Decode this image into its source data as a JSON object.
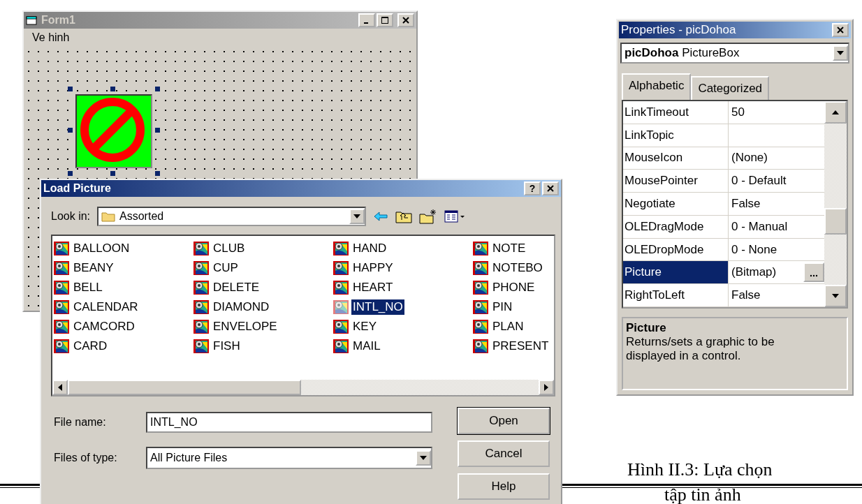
{
  "form_window": {
    "title": "Form1",
    "menu": [
      "Ve hinh"
    ]
  },
  "load_picture_dialog": {
    "title": "Load Picture",
    "help_glyph": "?",
    "look_in": {
      "label": "Look in:",
      "value": "Assorted"
    },
    "files": [
      {
        "name": "BALLOON",
        "selected": false
      },
      {
        "name": "BEANY",
        "selected": false
      },
      {
        "name": "BELL",
        "selected": false
      },
      {
        "name": "CALENDAR",
        "selected": false
      },
      {
        "name": "CAMCORD",
        "selected": false
      },
      {
        "name": "CARD",
        "selected": false
      },
      {
        "name": "CLUB",
        "selected": false
      },
      {
        "name": "CUP",
        "selected": false
      },
      {
        "name": "DELETE",
        "selected": false
      },
      {
        "name": "DIAMOND",
        "selected": false
      },
      {
        "name": "ENVELOPE",
        "selected": false
      },
      {
        "name": "FISH",
        "selected": false
      },
      {
        "name": "HAND",
        "selected": false
      },
      {
        "name": "HAPPY",
        "selected": false
      },
      {
        "name": "HEART",
        "selected": false
      },
      {
        "name": "INTL_NO",
        "selected": true
      },
      {
        "name": "KEY",
        "selected": false
      },
      {
        "name": "MAIL",
        "selected": false
      },
      {
        "name": "NOTE",
        "selected": false
      },
      {
        "name": "NOTEBO",
        "selected": false
      },
      {
        "name": "PHONE",
        "selected": false
      },
      {
        "name": "PIN",
        "selected": false
      },
      {
        "name": "PLAN",
        "selected": false
      },
      {
        "name": "PRESENT",
        "selected": false
      }
    ],
    "file_name": {
      "label": "File name:",
      "value": "INTL_NO"
    },
    "files_of_type": {
      "label": "Files of type:",
      "value": "All Picture Files"
    },
    "buttons": [
      {
        "label": "Open",
        "default": true
      },
      {
        "label": "Cancel",
        "default": false
      },
      {
        "label": "Help",
        "default": false
      }
    ]
  },
  "properties_window": {
    "title": "Properties - picDohoa",
    "object": "**picDohoa** PictureBox",
    "tabs": [
      {
        "label": "Alphabetic",
        "selected": true
      },
      {
        "label": "Categorized",
        "selected": false
      }
    ],
    "rows": [
      {
        "name": "LinkTimeout",
        "value": "50",
        "selected": false
      },
      {
        "name": "LinkTopic",
        "selected": false
      },
      {
        "name": "MouseIcon",
        "value": "(None)",
        "selected": false
      },
      {
        "name": "MousePointer",
        "value": "0 - Default",
        "selected": false
      },
      {
        "name": "Negotiate",
        "value": "False",
        "selected": false
      },
      {
        "name": "OLEDragMode",
        "value": "0 - Manual",
        "selected": false
      },
      {
        "name": "OLEDropMode",
        "value": "0 - None",
        "selected": false
      },
      {
        "name": "Picture",
        "value": "(Bitmap)",
        "selected": true
      },
      {
        "name": "RightToLeft",
        "value": "False",
        "selected": false
      }
    ],
    "description": {
      "title": "Picture",
      "text": "Returns/sets a graphic to be displayed in a control."
    }
  },
  "caption": [
    "Hình II.3: Lựa chọn",
    "tập tin ảnh"
  ]
}
